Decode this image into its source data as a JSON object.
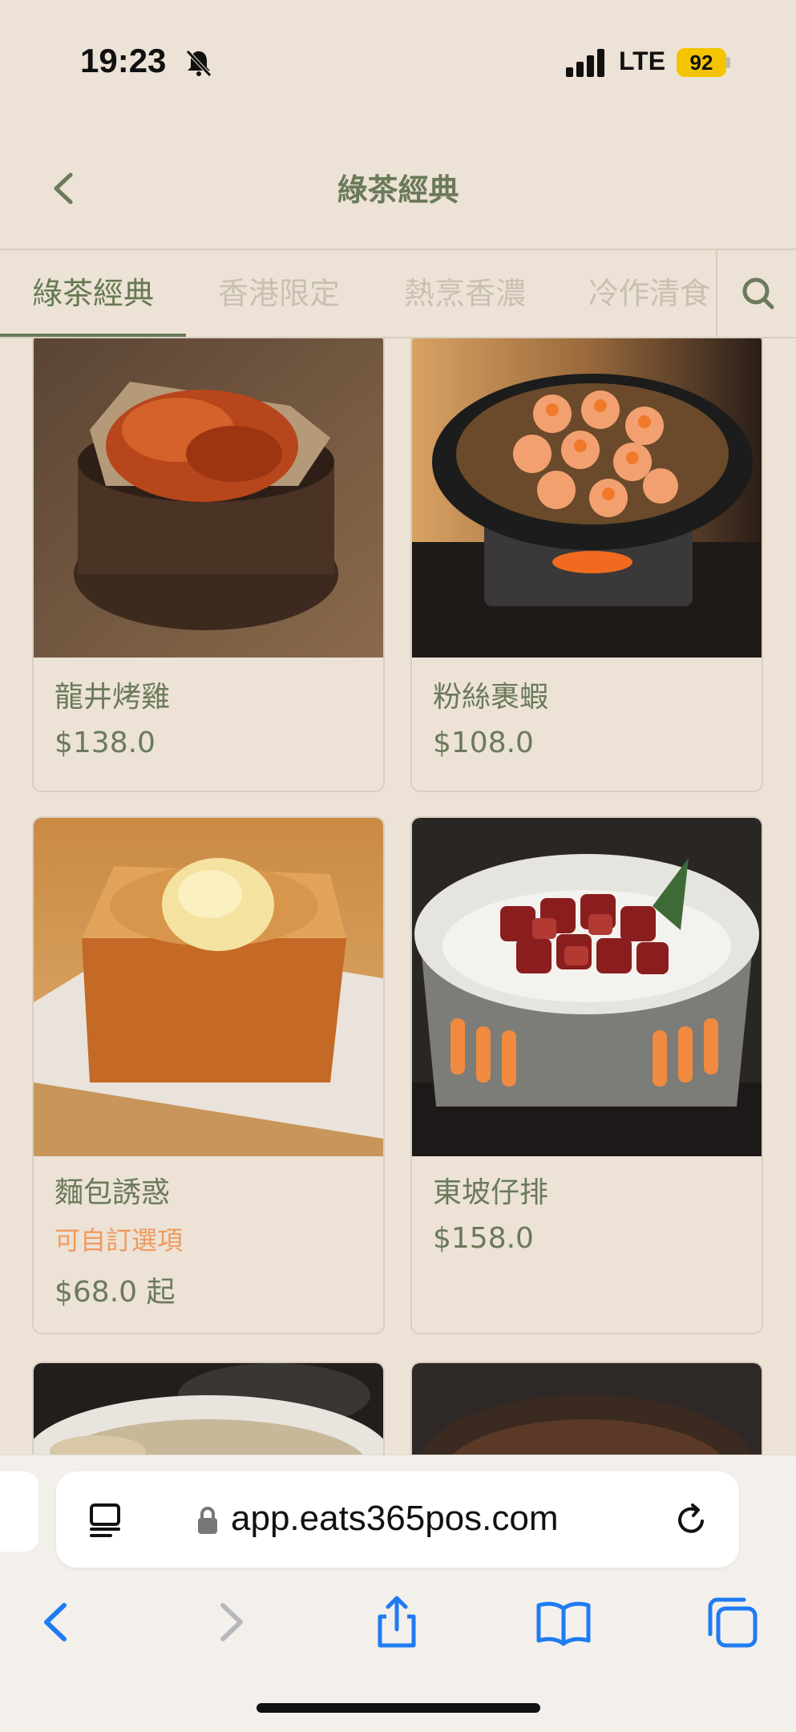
{
  "status_bar": {
    "time": "19:23",
    "network": "LTE",
    "battery": "92"
  },
  "header": {
    "title": "綠茶經典"
  },
  "tabs": [
    {
      "label": "綠茶經典",
      "active": true
    },
    {
      "label": "香港限定",
      "active": false
    },
    {
      "label": "熱烹香濃",
      "active": false
    },
    {
      "label": "冷作清食",
      "active": false
    }
  ],
  "products": [
    {
      "name": "龍井烤雞",
      "price": "$138.0",
      "image": "roast-chicken-in-wooden-bucket"
    },
    {
      "name": "粉絲裹蝦",
      "price": "$108.0",
      "image": "shrimp-vermicelli-claypot"
    },
    {
      "name": "麵包誘惑",
      "option": "可自訂選項",
      "price": "$68.0 起",
      "image": "honey-toast-with-ice-cream"
    },
    {
      "name": "東坡仔排",
      "price": "$158.0",
      "image": "braised-pork-ribs-in-warmer-dish"
    },
    {
      "name": "",
      "price": "",
      "image": "soup-bowl-partially-visible"
    },
    {
      "name": "",
      "price": "",
      "image": "dark-pot-partially-visible"
    }
  ],
  "browser": {
    "url": "app.eats365pos.com"
  },
  "colors": {
    "accent": "#6b7a5a",
    "option": "#f09a5e",
    "background": "#ece2d5",
    "ios_blue": "#1f7bf2"
  }
}
